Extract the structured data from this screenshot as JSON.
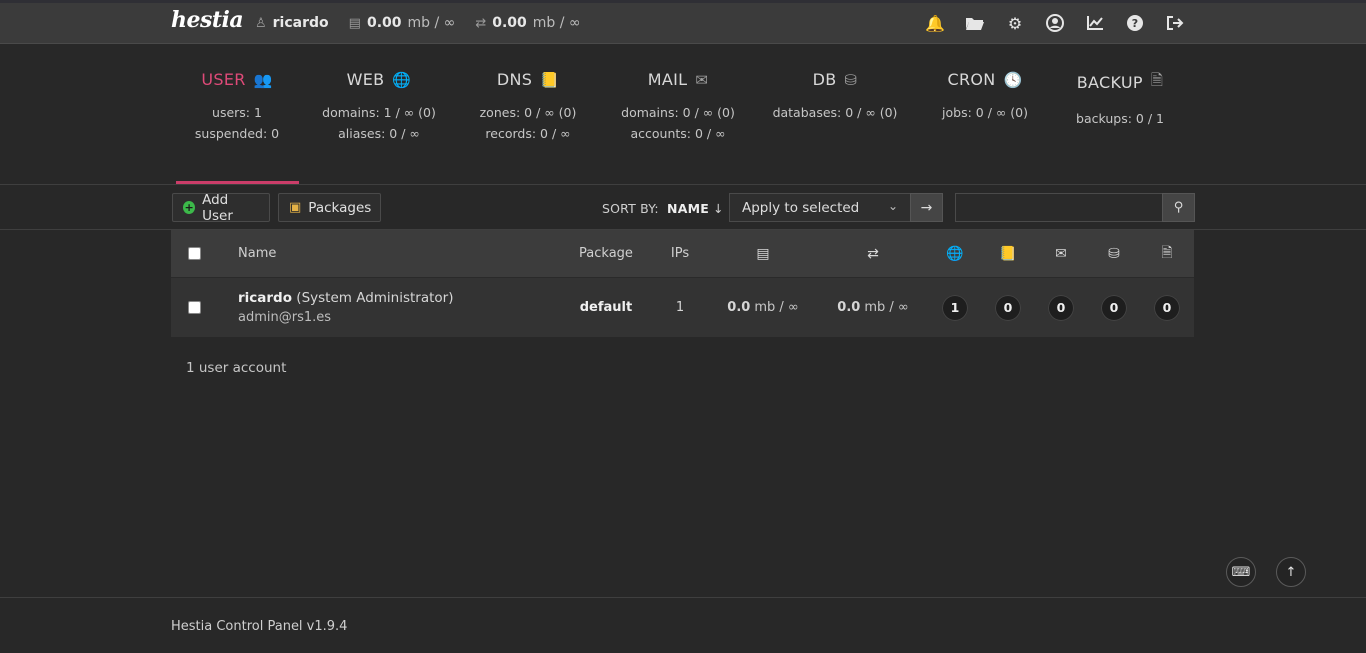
{
  "header": {
    "logo_text": "hestia",
    "username": "ricardo",
    "disk_value": "0.00",
    "disk_unit": "mb / ∞",
    "bandwidth_value": "0.00",
    "bandwidth_unit": "mb / ∞",
    "icons": [
      "bell-icon",
      "folder-icon",
      "gear-icon",
      "user-circle-icon",
      "chart-line-icon",
      "help-icon",
      "logout-icon"
    ]
  },
  "stats": [
    {
      "label": "USER",
      "icon": "users-icon",
      "lines": [
        "users: 1",
        "suspended: 0"
      ],
      "active": true
    },
    {
      "label": "WEB",
      "icon": "globe-icon",
      "lines": [
        "domains: 1 / ∞ (0)",
        "aliases: 0 / ∞"
      ]
    },
    {
      "label": "DNS",
      "icon": "address-book-icon",
      "lines": [
        "zones: 0 / ∞ (0)",
        "records: 0 / ∞"
      ]
    },
    {
      "label": "MAIL",
      "icon": "mail-bulk-icon",
      "lines": [
        "domains: 0 / ∞ (0)",
        "accounts: 0 / ∞"
      ]
    },
    {
      "label": "DB",
      "icon": "database-icon",
      "lines": [
        "databases: 0 / ∞ (0)"
      ]
    },
    {
      "label": "CRON",
      "icon": "clock-icon",
      "lines": [
        "jobs: 0 / ∞ (0)"
      ]
    },
    {
      "label": "BACKUP",
      "icon": "file-zipper-icon",
      "lines": [
        "backups: 0 / 1"
      ]
    }
  ],
  "toolbar": {
    "add_user_label": "Add User",
    "packages_label": "Packages",
    "sort_by_label": "SORT BY:",
    "sort_by_value": "NAME",
    "bulk_action_value": "Apply to selected",
    "search_placeholder": ""
  },
  "table": {
    "headers": {
      "name": "Name",
      "package": "Package",
      "ips": "IPs"
    },
    "rows": [
      {
        "username": "ricardo",
        "role": "(System Administrator)",
        "email": "admin@rs1.es",
        "package": "default",
        "ips": "1",
        "disk_value": "0.0",
        "disk_unit": "mb / ∞",
        "bandwidth_value": "0.0",
        "bandwidth_unit": "mb / ∞",
        "web": "1",
        "dns": "0",
        "mail": "0",
        "db": "0",
        "backup": "0"
      }
    ]
  },
  "summary": "1 user account",
  "footer": "Hestia Control Panel v1.9.4",
  "colors": {
    "accent": "#cb3d69",
    "background": "#282828",
    "bell": "#f0b400",
    "add": "#3cb94a"
  }
}
